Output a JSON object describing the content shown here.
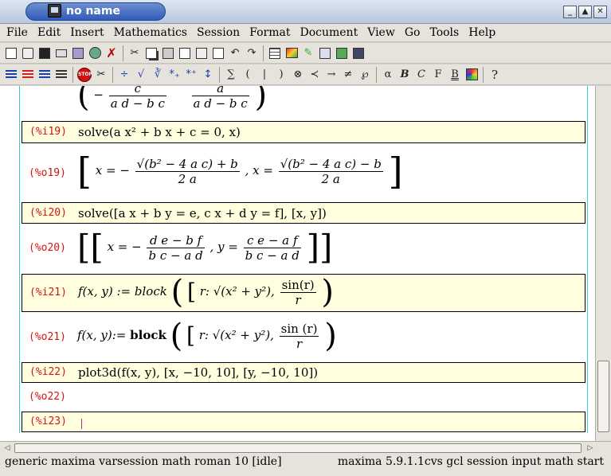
{
  "window": {
    "title": "no name",
    "buttons": [
      "_",
      "▲",
      "✕"
    ]
  },
  "menubar": {
    "items": [
      "File",
      "Edit",
      "Insert",
      "Mathematics",
      "Session",
      "Format",
      "Document",
      "View",
      "Go",
      "Tools",
      "Help"
    ]
  },
  "toolbar2": {
    "symbols": {
      "sum": "∑",
      "lparen": "(",
      "bar": "|",
      "rparen": ")",
      "otimes": "⊗",
      "prec": "≺",
      "arrow": "→",
      "neq": "≠",
      "weier": "℘",
      "alpha": "α",
      "bold": "B",
      "script": "C",
      "fraktur": "F",
      "blackboard": "B",
      "help": "?"
    }
  },
  "cells": {
    "o18_tail": {
      "frac1_num": "c",
      "frac1_den": "a d − b c",
      "frac2_num": "a",
      "frac2_den": "a d − b c",
      "minus": "−"
    },
    "i19": {
      "label": "(%i19)",
      "expr": "solve(a x² + b x + c = 0, x)"
    },
    "o19": {
      "label": "(%o19)",
      "x1_num": "√(b² − 4 a c) + b",
      "x1_den": "2 a",
      "x2_num": "√(b² − 4 a c) − b",
      "x2_den": "2 a",
      "lhs1": "x = −",
      "lhs2": ", x ="
    },
    "i20": {
      "label": "(%i20)",
      "expr": "solve([a x + b y = e, c x + d y = f], [x, y])"
    },
    "o20": {
      "label": "(%o20)",
      "x_num": "d e − b f",
      "x_den": "b c − a d",
      "y_num": "c e − a f",
      "y_den": "b c − a d",
      "lhs1": "x = −",
      "lhs2": ", y ="
    },
    "i21": {
      "label": "(%i21)",
      "lhs": "f(x, y) := block",
      "r": "r: √(x² + y²),",
      "sin_num": "sin(r)",
      "sin_den": "r"
    },
    "o21": {
      "label": "(%o21)",
      "lhs": "f(x, y):=",
      "block": "block",
      "r": "r: √(x² + y²),",
      "sin_num": "sin (r)",
      "sin_den": "r"
    },
    "i22": {
      "label": "(%i22)",
      "expr": "plot3d(f(x, y), [x, −10, 10], [y, −10, 10])"
    },
    "o22": {
      "label": "(%o22)"
    },
    "i23": {
      "label": "(%i23)"
    }
  },
  "statusbar": {
    "left": "generic maxima varsession math roman 10 [idle]",
    "right": "maxima 5.9.1.1cvs gcl session input math start"
  }
}
